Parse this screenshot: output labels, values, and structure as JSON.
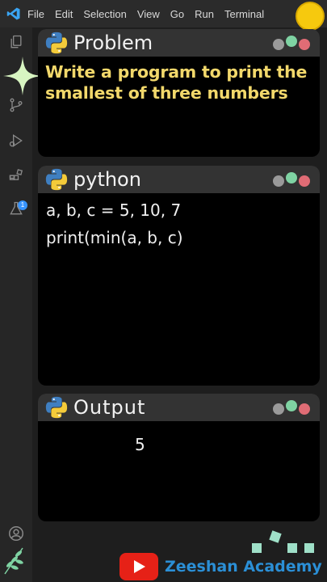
{
  "menubar": {
    "items": [
      "File",
      "Edit",
      "Selection",
      "View",
      "Go",
      "Run",
      "Terminal"
    ]
  },
  "activitybar": {
    "extensions_badge": "1"
  },
  "problem_panel": {
    "title": "Problem",
    "text": "Write a program to print the smallest of three numbers"
  },
  "code_panel": {
    "title": "python",
    "lines": [
      "a, b, c = 5, 10, 7",
      "print(min(a, b, c)"
    ]
  },
  "output_panel": {
    "title": "Output",
    "value": "5"
  },
  "brand": {
    "name": "Zeeshan Academy"
  },
  "colors": {
    "accent_yellow": "#f6c90e",
    "problem_text": "#f2d86b",
    "brand_blue": "#2b8fd6",
    "youtube_red": "#e62117"
  }
}
